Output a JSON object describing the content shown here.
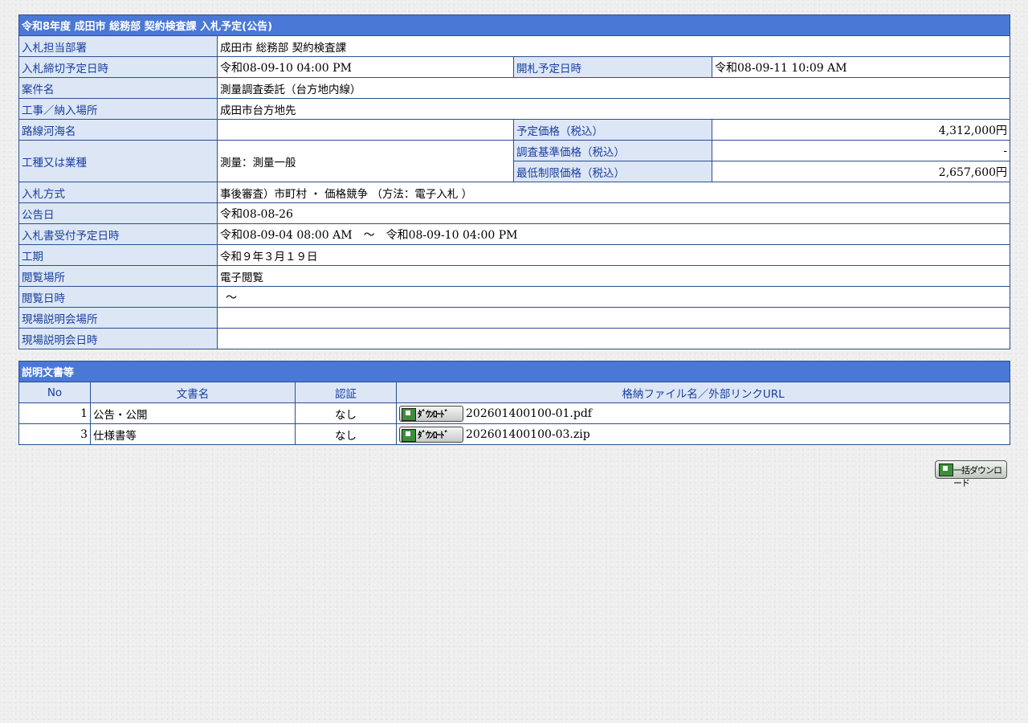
{
  "notice": {
    "title": "令和8年度 成田市 総務部 契約検査課 入札予定(公告)",
    "rows": {
      "dept": {
        "label": "入札担当部署",
        "value": "成田市 総務部 契約検査課"
      },
      "deadline": {
        "label": "入札締切予定日時",
        "value": "令和08-09-10 04:00 PM"
      },
      "opening": {
        "label": "開札予定日時",
        "value": "令和08-09-11 10:09 AM"
      },
      "case_name": {
        "label": "案件名",
        "value": "測量調査委託（台方地内線）"
      },
      "location": {
        "label": "工事／納入場所",
        "value": "成田市台方地先"
      },
      "route": {
        "label": "路線河海名",
        "value": ""
      },
      "planned_price": {
        "label": "予定価格（税込）",
        "value": "4,312,000円"
      },
      "work_type": {
        "label": "工種又は業種",
        "value": "測量：測量一般"
      },
      "survey_price": {
        "label": "調査基準価格（税込）",
        "value": "-"
      },
      "min_price": {
        "label": "最低制限価格（税込）",
        "value": "2,657,600円"
      },
      "method": {
        "label": "入札方式",
        "value": "事後審査）市町村 ・ 価格競争 （方法：電子入札 ）"
      },
      "announce_date": {
        "label": "公告日",
        "value": "令和08-08-26"
      },
      "receipt_period": {
        "label": "入札書受付予定日時",
        "value": "令和08-09-04 08:00 AM　～　令和08-09-10 04:00 PM"
      },
      "term": {
        "label": "工期",
        "value": "令和９年３月１９日"
      },
      "view_place": {
        "label": "閲覧場所",
        "value": "電子閲覧"
      },
      "view_date": {
        "label": "閲覧日時",
        "value": "～"
      },
      "site_place": {
        "label": "現場説明会場所",
        "value": ""
      },
      "site_date": {
        "label": "現場説明会日時",
        "value": ""
      }
    }
  },
  "documents": {
    "title": "説明文書等",
    "headers": {
      "no": "No",
      "name": "文書名",
      "auth": "認証",
      "file": "格納ファイル名／外部リンクURL"
    },
    "download_label": "ﾀﾞｳﾝﾛｰﾄﾞ",
    "items": [
      {
        "no": "1",
        "name": "公告・公開",
        "auth": "なし",
        "file": "202601400100-01.pdf"
      },
      {
        "no": "3",
        "name": "仕様書等",
        "auth": "なし",
        "file": "202601400100-03.zip"
      }
    ],
    "bulk_download_label": "一括ダウンロード"
  }
}
